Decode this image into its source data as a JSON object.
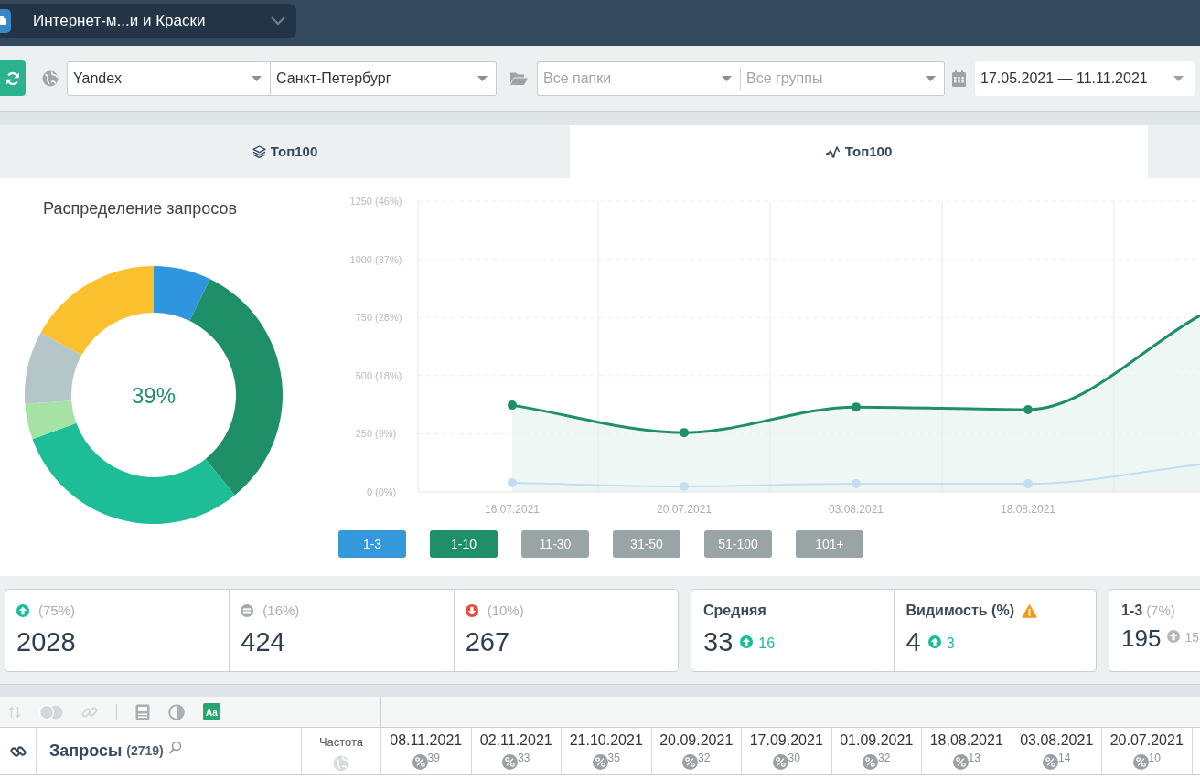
{
  "project_selector": {
    "label": "Интернет-м...и и Краски"
  },
  "filters": {
    "search_engine": {
      "value": "Yandex"
    },
    "region": {
      "value": "Санкт-Петербург"
    },
    "folder": {
      "placeholder": "Все папки"
    },
    "group": {
      "placeholder": "Все группы"
    },
    "period": {
      "value": "17.05.2021 — 11.11.2021"
    }
  },
  "tabs": [
    {
      "kind": "layers",
      "label": "Топ100",
      "selected": false
    },
    {
      "kind": "line",
      "label": "Топ100",
      "selected": true
    }
  ],
  "distribution": {
    "title": "Распределение запросов",
    "center_label": "39%"
  },
  "positions_chart": {
    "chart_data": {
      "type": "area",
      "categories": [
        "16.07.2021",
        "20.07.2021",
        "03.08.2021",
        "18.08.2021",
        null
      ],
      "ylim": [
        0,
        1250
      ],
      "yticks": [
        {
          "value": 0,
          "label": "0"
        },
        {
          "value": 250,
          "label": "250"
        },
        {
          "value": 500,
          "label": "500"
        },
        {
          "value": 750,
          "label": "750"
        },
        {
          "value": 1000,
          "label": "1000"
        },
        {
          "value": 1250,
          "label": "1250"
        }
      ],
      "grid": true,
      "series": [
        {
          "color": "#1f8f6a",
          "values": [
            373,
            255,
            365,
            354,
            758
          ]
        },
        {
          "color": "#c3def3",
          "values": [
            39,
            24,
            35,
            35,
            118
          ]
        }
      ]
    },
    "ytick_shares": [
      "(46%)",
      "(37%)",
      "(28%)",
      "(18%)",
      "(9%)",
      "(0%)"
    ],
    "range_toggles": [
      {
        "label": "1-3",
        "selected": true,
        "color": "#3498db"
      },
      {
        "label": "1-10",
        "selected": true,
        "color": "#1f8f6a"
      },
      {
        "label": "11-30",
        "selected": false
      },
      {
        "label": "31-50",
        "selected": false
      },
      {
        "label": "51-100",
        "selected": false
      },
      {
        "label": "101+",
        "selected": false
      }
    ]
  },
  "summary": {
    "changes": [
      {
        "kind": "up",
        "share": "(75%)",
        "value": "2028"
      },
      {
        "kind": "same",
        "share": "(16%)",
        "value": "424"
      },
      {
        "kind": "down",
        "share": "(10%)",
        "value": "267"
      }
    ],
    "metrics": [
      {
        "label": "Средняя",
        "warning": false,
        "value": "33",
        "delta": {
          "kind": "up",
          "muted": false,
          "text": "16"
        }
      },
      {
        "label": "Видимость (%)",
        "warning": true,
        "value": "4",
        "delta": {
          "kind": "up",
          "muted": false,
          "text": "3"
        }
      }
    ],
    "range_card": {
      "label": "1-3",
      "share": "(7%)",
      "value": "195",
      "delta": {
        "kind": "up",
        "muted": true,
        "text": "15"
      }
    }
  },
  "table": {
    "toolbar": {
      "left_tools": [
        {
          "kind": "sort",
          "disabled": true
        },
        {
          "kind": "toggle",
          "disabled": true
        },
        {
          "kind": "link",
          "disabled": true
        }
      ],
      "right_tools": [
        {
          "kind": "save",
          "disabled": false
        },
        {
          "kind": "contrast",
          "disabled": false
        },
        {
          "kind": "text_style",
          "label": "Aa",
          "disabled": false
        }
      ]
    },
    "columns": [
      {
        "kind": "link"
      },
      {
        "kind": "query",
        "label": "Запросы",
        "count": "(2719)"
      },
      {
        "kind": "frequency",
        "label": "Частота"
      },
      {
        "kind": "date",
        "label": "08.11.2021",
        "badge": "39"
      },
      {
        "kind": "date",
        "label": "02.11.2021",
        "badge": "33"
      },
      {
        "kind": "date",
        "label": "21.10.2021",
        "badge": "35"
      },
      {
        "kind": "date",
        "label": "20.09.2021",
        "badge": "32"
      },
      {
        "kind": "date",
        "label": "17.09.2021",
        "badge": "30"
      },
      {
        "kind": "date",
        "label": "01.09.2021",
        "badge": "32"
      },
      {
        "kind": "date",
        "label": "18.08.2021",
        "badge": "13"
      },
      {
        "kind": "date",
        "label": "03.08.2021",
        "badge": "14"
      },
      {
        "kind": "date",
        "label": "20.07.2021",
        "badge": "10"
      }
    ]
  }
}
